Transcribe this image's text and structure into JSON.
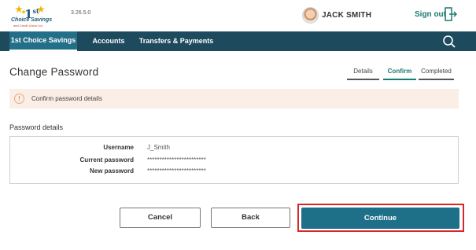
{
  "header": {
    "logo": {
      "number": "1",
      "superscript": "st",
      "name": "Choice Savings",
      "tagline": "and Credit Union Ltd."
    },
    "version": "3.26.5.0",
    "user_name": "JACK SMITH",
    "signout_label": "Sign out"
  },
  "nav": {
    "items": [
      {
        "label": "1st Choice Savings",
        "active": true
      },
      {
        "label": "Accounts",
        "active": false
      },
      {
        "label": "Transfers & Payments",
        "active": false
      }
    ]
  },
  "page": {
    "title": "Change Password",
    "steps": [
      {
        "label": "Details",
        "active": false
      },
      {
        "label": "Confirm",
        "active": true
      },
      {
        "label": "Completed",
        "active": false
      }
    ]
  },
  "alert": {
    "icon": "!",
    "text": "Confirm password details"
  },
  "details": {
    "section_title": "Password details",
    "rows": [
      {
        "label": "Username",
        "value": "J_Smith"
      },
      {
        "label": "Current password",
        "value": "************************"
      },
      {
        "label": "New password",
        "value": "************************"
      }
    ]
  },
  "buttons": {
    "cancel": "Cancel",
    "back": "Back",
    "continue": "Continue"
  },
  "colors": {
    "nav_bg": "#1e4a5e",
    "accent": "#1a7a6e",
    "primary_button": "#1e6f88",
    "alert_bg": "#fbeee6",
    "highlight": "#d9262c"
  }
}
